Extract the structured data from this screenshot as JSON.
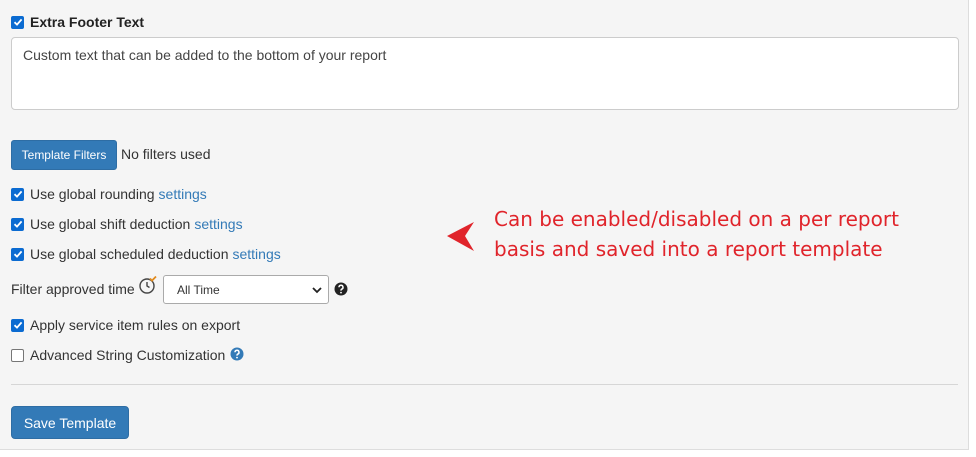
{
  "footer": {
    "checkbox_label": "Extra Footer Text",
    "checked": true,
    "text": "Custom text that can be added to the bottom of your report"
  },
  "filters": {
    "button_label": "Template Filters",
    "status": "No filters used"
  },
  "options": {
    "global_rounding": {
      "label": "Use global rounding",
      "link": "settings",
      "checked": true
    },
    "shift_deduction": {
      "label": "Use global shift deduction",
      "link": "settings",
      "checked": true
    },
    "scheduled_deduction": {
      "label": "Use global scheduled deduction",
      "link": "settings",
      "checked": true
    },
    "service_rules": {
      "label": "Apply service item rules on export",
      "checked": true
    },
    "advanced_strings": {
      "label": "Advanced String Customization",
      "checked": false
    }
  },
  "approved_filter": {
    "label": "Filter approved time",
    "selected": "All Time"
  },
  "actions": {
    "save_label": "Save Template"
  },
  "annotation": {
    "text": "Can be enabled/disabled on a per report basis and saved into a report template",
    "color": "#e0242b"
  },
  "icons": {
    "clock": "clock-check-icon",
    "question": "question-circle-icon",
    "arrow": "red-arrow-pointer-icon"
  },
  "colors": {
    "primary": "#337ab7",
    "checkbox": "#0b6bd1",
    "link": "#337ab7"
  }
}
